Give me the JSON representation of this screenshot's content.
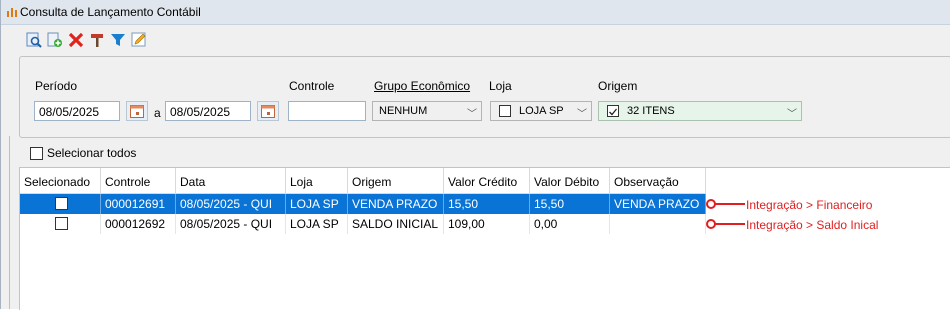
{
  "window": {
    "title": "Consulta de Lançamento Contábil"
  },
  "toolbar": {
    "icons": [
      "search-icon",
      "new-document-icon",
      "delete-icon",
      "hammer-icon",
      "filter-icon",
      "edit-icon"
    ]
  },
  "filters": {
    "periodo_label": "Período",
    "date_from": "08/05/2025",
    "date_sep": "a",
    "date_to": "08/05/2025",
    "controle_label": "Controle",
    "controle_value": "",
    "grupo_label": "Grupo Econômico",
    "grupo_value": "NENHUM",
    "loja_label": "Loja",
    "loja_value": "LOJA SP",
    "origem_label": "Origem",
    "origem_value": "32 ITENS"
  },
  "select_all_label": "Selecionar todos",
  "table": {
    "headers": [
      "Selecionado",
      "Controle",
      "Data",
      "Loja",
      "Origem",
      "Valor Crédito",
      "Valor Débito",
      "Observação"
    ],
    "rows": [
      {
        "controle": "000012691",
        "data": "08/05/2025 - QUI",
        "loja": "LOJA SP",
        "origem": "VENDA PRAZO",
        "credito": "15,50",
        "debito": "15,50",
        "obs": "VENDA PRAZO",
        "selected": true
      },
      {
        "controle": "000012692",
        "data": "08/05/2025 - QUI",
        "loja": "LOJA SP",
        "origem": "SALDO INICIAL",
        "credito": "109,00",
        "debito": "0,00",
        "obs": "",
        "selected": false
      }
    ]
  },
  "annotations": [
    "Integração > Financeiro",
    "Integração > Saldo Inical"
  ],
  "colors": {
    "selection": "#0a74d6",
    "annotation": "#e02020",
    "origem_field": "#e6f4ea"
  }
}
